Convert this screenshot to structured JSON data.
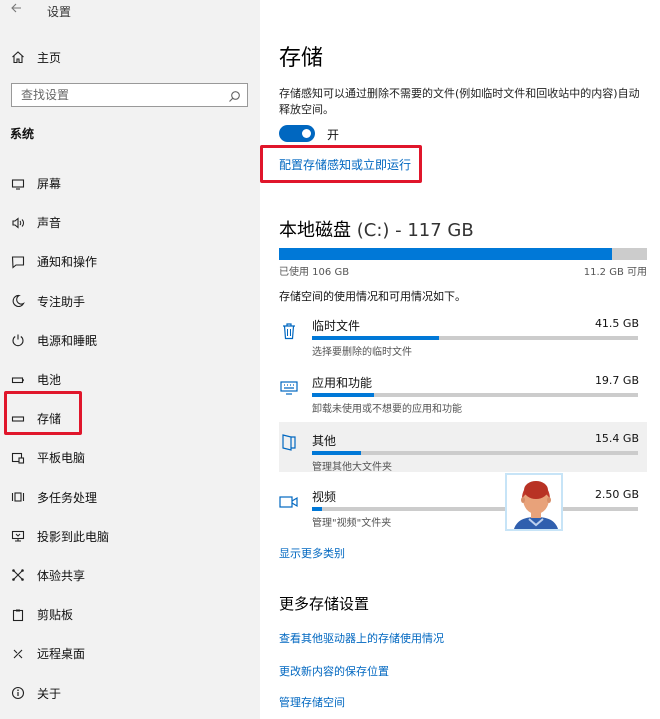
{
  "window": {
    "title": "设置"
  },
  "sidebar": {
    "home_label": "主页",
    "search_placeholder": "查找设置",
    "section_label": "系统",
    "items": [
      {
        "label": "屏幕",
        "icon": "monitor-icon"
      },
      {
        "label": "声音",
        "icon": "speaker-icon"
      },
      {
        "label": "通知和操作",
        "icon": "notification-icon"
      },
      {
        "label": "专注助手",
        "icon": "moon-icon"
      },
      {
        "label": "电源和睡眠",
        "icon": "power-icon"
      },
      {
        "label": "电池",
        "icon": "battery-icon"
      },
      {
        "label": "存储",
        "icon": "storage-icon"
      },
      {
        "label": "平板电脑",
        "icon": "tablet-icon"
      },
      {
        "label": "多任务处理",
        "icon": "multitask-icon"
      },
      {
        "label": "投影到此电脑",
        "icon": "project-icon"
      },
      {
        "label": "体验共享",
        "icon": "share-icon"
      },
      {
        "label": "剪贴板",
        "icon": "clipboard-icon"
      },
      {
        "label": "远程桌面",
        "icon": "remote-desktop-icon"
      },
      {
        "label": "关于",
        "icon": "info-icon"
      }
    ]
  },
  "main": {
    "title": "存储",
    "description": "存储感知可以通过删除不需要的文件(例如临时文件和回收站中的内容)自动释放空间。",
    "toggle": {
      "state": "on",
      "label": "开"
    },
    "configure_link": "配置存储感知或立即运行",
    "disk": {
      "title": "本地磁盘",
      "drive": "(C:) - 117 GB",
      "used_fraction": 0.906,
      "used_label": "已使用 106 GB",
      "free_label": "11.2 GB 可用"
    },
    "usage_desc": "存储空间的使用情况和可用情况如下。",
    "categories": [
      {
        "name": "临时文件",
        "size": "41.5 GB",
        "sub": "选择要删除的临时文件",
        "fraction": 0.39,
        "icon": "trash-icon"
      },
      {
        "name": "应用和功能",
        "size": "19.7 GB",
        "sub": "卸载未使用或不想要的应用和功能",
        "fraction": 0.19,
        "icon": "keyboard-icon"
      },
      {
        "name": "其他",
        "size": "15.4 GB",
        "sub": "管理其他大文件夹",
        "fraction": 0.15,
        "icon": "folder-icon"
      },
      {
        "name": "视频",
        "size": "2.50 GB",
        "sub": "管理\"视频\"文件夹",
        "fraction": 0.03,
        "icon": "video-icon"
      }
    ],
    "more_categories": "显示更多类别",
    "more_settings_title": "更多存储设置",
    "links": [
      "查看其他驱动器上的存储使用情况",
      "更改新内容的保存位置",
      "管理存储空间"
    ]
  },
  "colors": {
    "accent": "#0078d7",
    "link": "#0067c0",
    "highlight": "#e0162b",
    "sidebar_bg": "#f2f2f2"
  }
}
